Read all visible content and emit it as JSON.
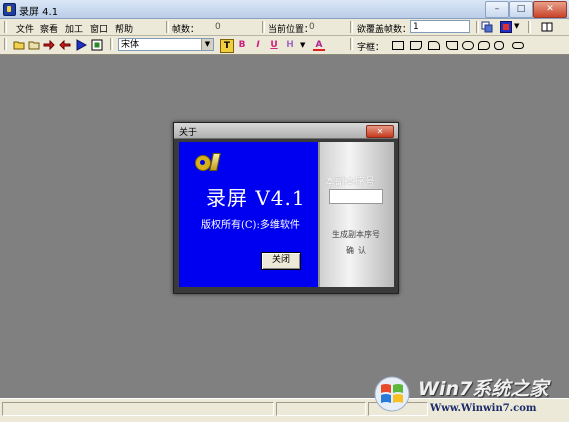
{
  "window": {
    "title": "录屏 4.1",
    "minimize": "–",
    "maximize": "□",
    "close": "✕"
  },
  "menu": [
    "文件",
    "察看",
    "加工",
    "窗口",
    "帮助"
  ],
  "info": {
    "frames_label": "帧数：",
    "frames_value": "0",
    "position_label": "当前位置：",
    "position_value": "0",
    "cover_frames_label": "欲覆盖帧数：",
    "cover_frames_value": "1"
  },
  "toolbar": {
    "font_name": "宋体",
    "bold": "B",
    "italic": "I",
    "underline": "U",
    "text_color": "A",
    "shape_label": "字框："
  },
  "about_dialog": {
    "title": "关于",
    "close_x": "✕",
    "app_name": "录屏  V4.1",
    "copyright": "版权所有(C):多维软件",
    "close_button": "关闭",
    "serial_label": "本副本序号",
    "generate_label": "生成副本序号",
    "confirm_label": "确认"
  },
  "watermark": {
    "brand": "Win7系统之家",
    "url": "Www.Winwin7.com"
  },
  "colors": {
    "dialog_blue": "#0000f0",
    "background": "#808080",
    "chrome": "#ece9d8"
  }
}
